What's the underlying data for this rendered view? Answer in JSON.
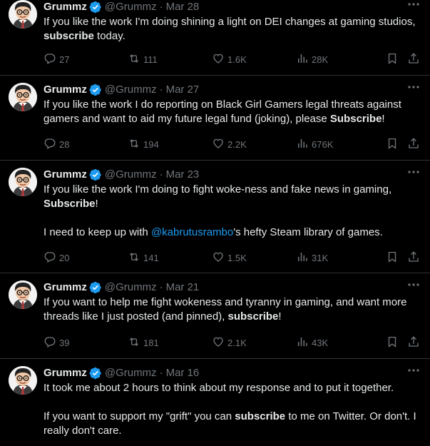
{
  "tweets": [
    {
      "name": "Grummz",
      "handle": "@Grummz",
      "separator": "·",
      "date": "Mar 28",
      "text_segments": [
        {
          "t": "If you like the work I'm doing shining a light on DEI changes at gaming studios, "
        },
        {
          "b": "subscribe"
        },
        {
          "t": " today."
        }
      ],
      "replies": "27",
      "reposts": "111",
      "likes": "1.6K",
      "views": "28K"
    },
    {
      "name": "Grummz",
      "handle": "@Grummz",
      "separator": "·",
      "date": "Mar 27",
      "text_segments": [
        {
          "t": "If you like the work I do reporting on Black Girl Gamers legal threats against gamers and want to aid my future legal fund (joking), please "
        },
        {
          "b": "Subscribe"
        },
        {
          "t": "!"
        }
      ],
      "replies": "28",
      "reposts": "194",
      "likes": "2.2K",
      "views": "676K"
    },
    {
      "name": "Grummz",
      "handle": "@Grummz",
      "separator": "·",
      "date": "Mar 23",
      "text_segments": [
        {
          "t": "If you like the work I'm doing to fight woke-ness and fake news in gaming, "
        },
        {
          "b": "Subscribe"
        },
        {
          "t": "!"
        },
        {
          "gap": true
        },
        {
          "t": "I need to keep up with "
        },
        {
          "m": "@kabrutusrambo"
        },
        {
          "t": "'s hefty Steam library of games."
        }
      ],
      "replies": "20",
      "reposts": "141",
      "likes": "1.5K",
      "views": "31K"
    },
    {
      "name": "Grummz",
      "handle": "@Grummz",
      "separator": "·",
      "date": "Mar 21",
      "text_segments": [
        {
          "t": "If you want to help me fight wokeness and tyranny in gaming, and want more threads like I just posted (and pinned), "
        },
        {
          "b": "subscribe"
        },
        {
          "t": "!"
        }
      ],
      "replies": "39",
      "reposts": "181",
      "likes": "2.1K",
      "views": "43K"
    },
    {
      "name": "Grummz",
      "handle": "@Grummz",
      "separator": "·",
      "date": "Mar 16",
      "text_segments": [
        {
          "t": "It took me about 2 hours to think about my response and to put it together."
        },
        {
          "gap": true
        },
        {
          "t": "If you want to support my \"grift\" you can "
        },
        {
          "b": "subscribe"
        },
        {
          "t": " to me on Twitter. Or don't. I really don't care."
        }
      ]
    }
  ],
  "icons": {
    "verified": "verified-badge-icon",
    "more": "more-dots-icon",
    "reply": "reply-icon",
    "repost": "repost-icon",
    "like": "heart-icon",
    "views": "views-bar-chart-icon",
    "bookmark": "bookmark-icon",
    "share": "share-icon"
  },
  "colors": {
    "background": "#000000",
    "text": "#e7e9ea",
    "muted": "#71767b",
    "accent": "#1d9bf0",
    "divider": "#2f3336"
  }
}
